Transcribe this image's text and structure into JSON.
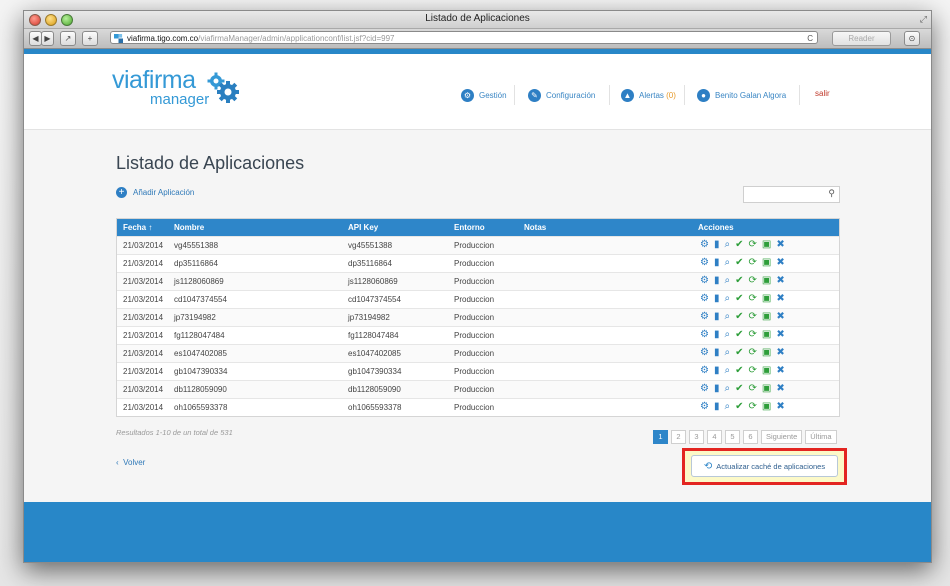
{
  "window": {
    "title": "Listado de Aplicaciones",
    "url_host": "viafirma.tigo.com.co",
    "url_path": "/viafirmaManager/admin/applicationconf/list.jsf?cid=997",
    "reader_label": "Reader"
  },
  "header": {
    "logo_word": "viafirma",
    "logo_sub": "manager",
    "nav": {
      "gestion": "Gestión",
      "config": "Configuración",
      "alertas": "Alertas",
      "alertas_count": "(0)",
      "user": "Benito Galan Algora",
      "salir": "salir"
    }
  },
  "main": {
    "title": "Listado de Aplicaciones",
    "add_label": "Añadir Aplicación",
    "search_placeholder": "",
    "columns": {
      "fecha": "Fecha ↑",
      "nombre": "Nombre",
      "apikey": "API Key",
      "entorno": "Entorno",
      "notas": "Notas",
      "acciones": "Acciones"
    },
    "rows": [
      {
        "fecha": "21/03/2014",
        "nombre": "vg45551388",
        "apikey": "vg45551388",
        "entorno": "Produccion",
        "notas": ""
      },
      {
        "fecha": "21/03/2014",
        "nombre": "dp35116864",
        "apikey": "dp35116864",
        "entorno": "Produccion",
        "notas": ""
      },
      {
        "fecha": "21/03/2014",
        "nombre": "js1128060869",
        "apikey": "js1128060869",
        "entorno": "Produccion",
        "notas": ""
      },
      {
        "fecha": "21/03/2014",
        "nombre": "cd1047374554",
        "apikey": "cd1047374554",
        "entorno": "Produccion",
        "notas": ""
      },
      {
        "fecha": "21/03/2014",
        "nombre": "jp73194982",
        "apikey": "jp73194982",
        "entorno": "Produccion",
        "notas": ""
      },
      {
        "fecha": "21/03/2014",
        "nombre": "fg1128047484",
        "apikey": "fg1128047484",
        "entorno": "Produccion",
        "notas": ""
      },
      {
        "fecha": "21/03/2014",
        "nombre": "es1047402085",
        "apikey": "es1047402085",
        "entorno": "Produccion",
        "notas": ""
      },
      {
        "fecha": "21/03/2014",
        "nombre": "gb1047390334",
        "apikey": "gb1047390334",
        "entorno": "Produccion",
        "notas": ""
      },
      {
        "fecha": "21/03/2014",
        "nombre": "db1128059090",
        "apikey": "db1128059090",
        "entorno": "Produccion",
        "notas": ""
      },
      {
        "fecha": "21/03/2014",
        "nombre": "oh1065593378",
        "apikey": "oh1065593378",
        "entorno": "Produccion",
        "notas": ""
      }
    ],
    "action_icons": [
      "gear-icon",
      "bar-chart-icon",
      "log-search-icon",
      "check-circle-icon",
      "sync-icon",
      "save-icon",
      "delete-icon"
    ],
    "results_text": "Resultados 1-10 de un total de 531",
    "pager": {
      "pages": [
        "1",
        "2",
        "3",
        "4",
        "5",
        "6"
      ],
      "current": "1",
      "next": "Siguiente",
      "last": "Última"
    },
    "volver": "Volver",
    "refresh_button": "Actualizar caché de aplicaciones"
  },
  "colors": {
    "brand_blue": "#2887c8",
    "highlight_border": "#e32521",
    "highlight_fill": "#fcf9c8",
    "alert_orange": "#e69a2b",
    "salir_red": "#c0392b"
  }
}
